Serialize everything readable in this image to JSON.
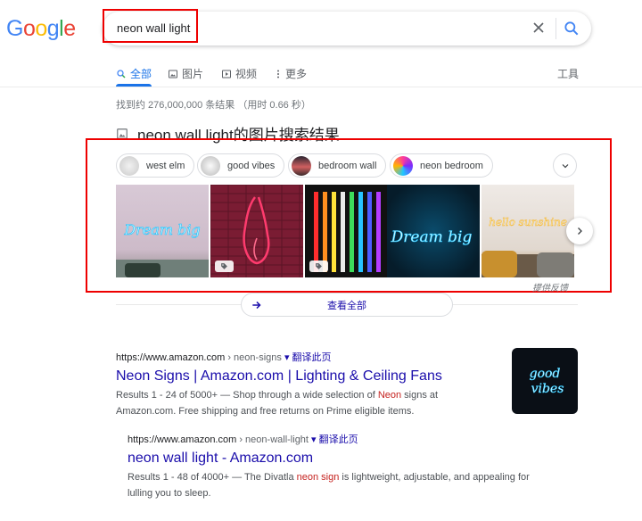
{
  "logo": [
    "G",
    "o",
    "o",
    "g",
    "l",
    "e"
  ],
  "logo_colors": [
    "#4285f4",
    "#ea4335",
    "#fbbc05",
    "#4285f4",
    "#34a853",
    "#ea4335"
  ],
  "search": {
    "query": "neon wall light",
    "clear_icon": "close-icon",
    "submit_icon": "search-icon"
  },
  "tabs": [
    {
      "label": "全部",
      "icon": "search-icon",
      "active": true
    },
    {
      "label": "图片",
      "icon": "image-icon"
    },
    {
      "label": "视频",
      "icon": "play-icon"
    },
    {
      "label": "更多",
      "icon": "more-vert-icon"
    }
  ],
  "tools_label": "工具",
  "stats": "找到约 276,000,000 条结果 （用时 0.66 秒）",
  "images_section": {
    "heading": "neon wall light的图片搜索结果",
    "chips": [
      {
        "label": "west elm"
      },
      {
        "label": "good vibes"
      },
      {
        "label": "bedroom wall"
      },
      {
        "label": "neon bedroom"
      }
    ],
    "tiles": [
      {
        "text": "Dream big",
        "has_tag": false
      },
      {
        "text": "",
        "has_tag": true
      },
      {
        "text": "",
        "has_tag": true
      },
      {
        "text": "Dream big",
        "has_tag": false
      },
      {
        "text": "hello sunshine",
        "has_tag": false
      }
    ],
    "feedback": "提供反馈",
    "view_all": "查看全部"
  },
  "results": [
    {
      "url": "https://www.amazon.com",
      "path": " › neon-signs",
      "translate": "翻译此页",
      "title": "Neon Signs | Amazon.com | Lighting & Ceiling Fans",
      "snippet_a": "Results 1 - 24 of 5000+ — Shop through a wide selection of ",
      "snippet_em": "Neon",
      "snippet_b": " signs at Amazon.com. Free shipping and free returns on Prime eligible items.",
      "thumb_text_1": "good",
      "thumb_text_2": "vibes"
    },
    {
      "url": "https://www.amazon.com",
      "path": " › neon-wall-light",
      "translate": "翻译此页",
      "title": "neon wall light - Amazon.com",
      "snippet_a": "Results 1 - 48 of 4000+ — The Divatla ",
      "snippet_em": "neon sign",
      "snippet_b": " is lightweight, adjustable, and appealing for lulling you to sleep."
    }
  ]
}
